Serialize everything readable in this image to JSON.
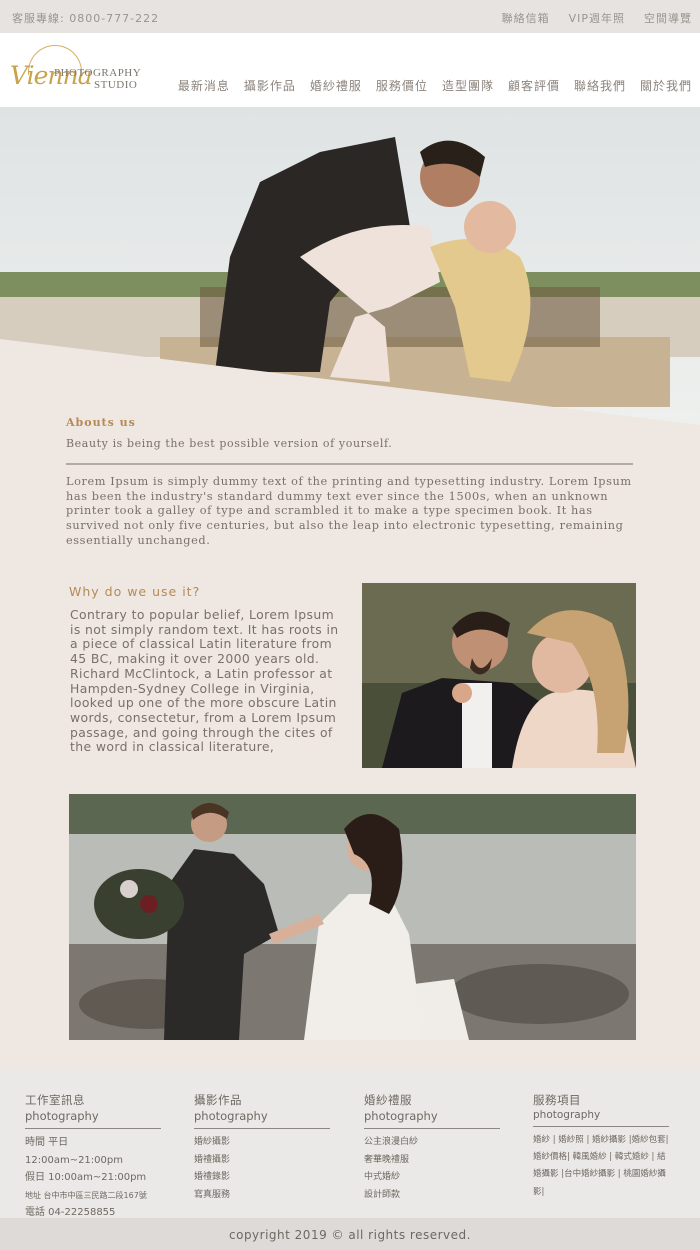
{
  "topbar": {
    "hotline": "客服專線: 0800-777-222",
    "links": [
      "聯絡信箱",
      "VIP週年照",
      "空間導覽"
    ]
  },
  "logo": {
    "script": "Vienna",
    "line1": "PHOTOGRAPHY",
    "line2": "STUDIO",
    "accent": "#c9a24c"
  },
  "nav": [
    "最新消息",
    "攝影作品",
    "婚紗禮服",
    "服務價位",
    "造型團隊",
    "顧客評價",
    "聯絡我們",
    "關於我們"
  ],
  "about": {
    "title": "Abouts us",
    "subtitle": "Beauty is being the best possible version of yourself.",
    "body": "Lorem Ipsum is simply dummy text of the printing and typesetting industry. Lorem Ipsum has been the industry's standard dummy text ever since the 1500s, when an unknown printer took a galley of type and scrambled it to make a type specimen book. It has survived not only five centuries, but also the leap into electronic typesetting, remaining essentially unchanged."
  },
  "why": {
    "title": "Why do we use it?",
    "body": "Contrary to popular belief, Lorem Ipsum is not simply random text. It has roots in a piece of classical Latin literature from 45 BC, making it over 2000 years old. Richard McClintock, a Latin professor at Hampden-Sydney College in Virginia, looked up one of the more obscure Latin words, consectetur, from a Lorem Ipsum passage, and going through the cites of the word in classical literature,"
  },
  "footer": {
    "studio": {
      "title": "工作室訊息",
      "subtitle": "photography",
      "lines": [
        "時間 平日12:00am~21:00pm",
        "假日 10:00am~21:00pm",
        "地址 台中市中區三民路二段167號",
        "電話 04-22258855"
      ]
    },
    "works": {
      "title": "攝影作品",
      "subtitle": "photography",
      "items": [
        "婚紗攝影",
        "婚禮攝影",
        "婚禮錄影",
        "寫真服務"
      ]
    },
    "gowns": {
      "title": "婚紗禮服",
      "subtitle": "photography",
      "items": [
        "公主浪漫白紗",
        "奢華晚禮服",
        "中式婚紗",
        "設計師款"
      ]
    },
    "services": {
      "title": "服務項目",
      "subtitle": "photography",
      "text": "婚紗 | 婚紗照 | 婚紗攝影 |婚紗包套| 婚紗價格| 韓風婚紗 | 韓式婚紗 | 結婚攝影 |台中婚紗攝影 | 桃園婚紗攝影|"
    }
  },
  "copyright": "copyright 2019 © all rights reserved."
}
